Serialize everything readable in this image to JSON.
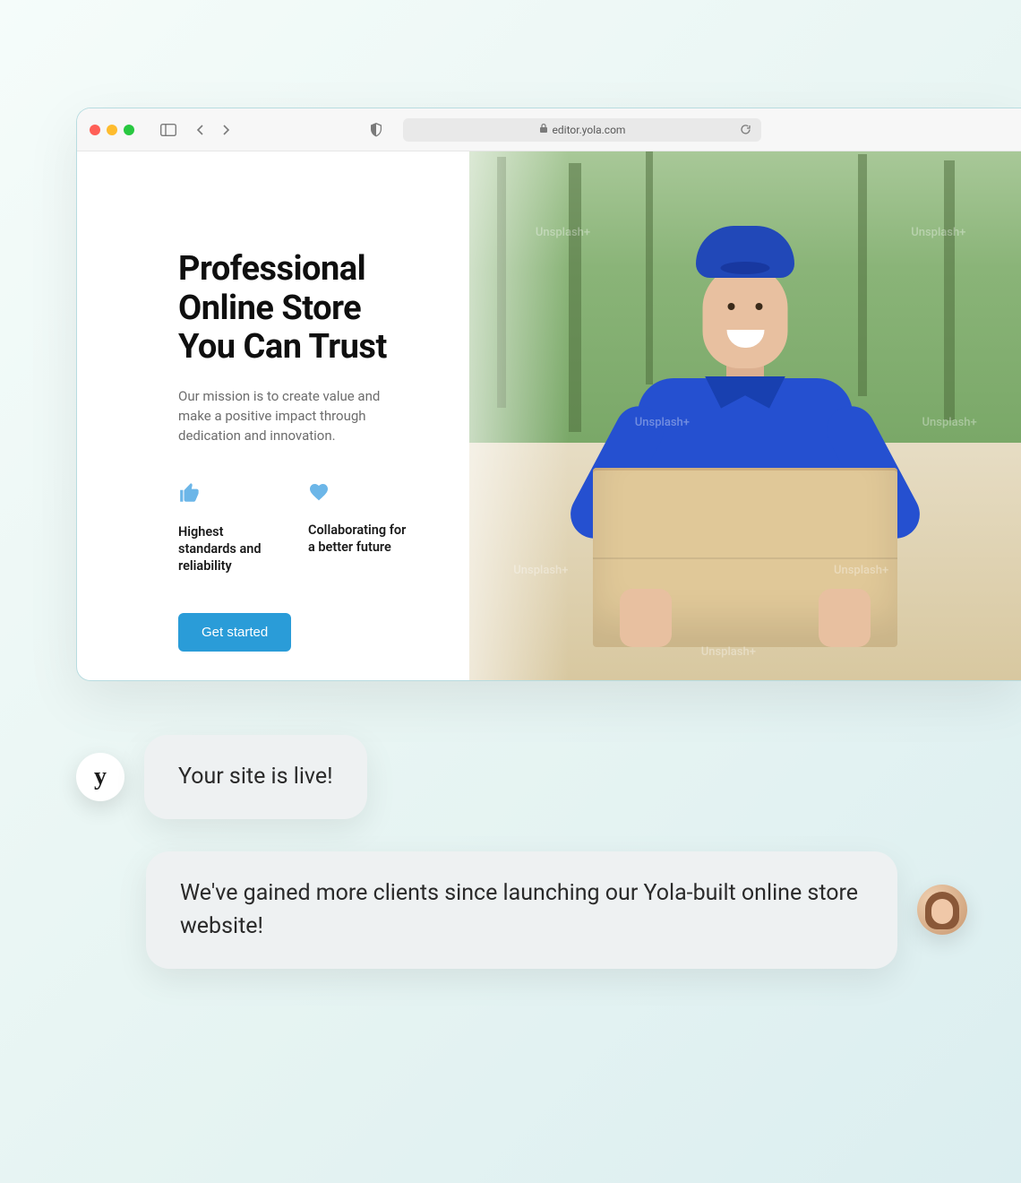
{
  "browser": {
    "url": "editor.yola.com"
  },
  "site": {
    "hero_title": "Professional Online Store You Can Trust",
    "hero_subtitle": "Our mission is to create value and make a positive impact through dedication and innovation.",
    "features": [
      {
        "icon": "thumbs-up",
        "text": "Highest standards and reliability"
      },
      {
        "icon": "heart",
        "text": "Collaborating for a better future"
      }
    ],
    "cta_label": "Get started",
    "watermark_text": "Unsplash+"
  },
  "chat": {
    "assistant_badge": "y",
    "message_1": "Your site is live!",
    "message_2": "We've gained more clients since launching our Yola-built online store website!"
  }
}
